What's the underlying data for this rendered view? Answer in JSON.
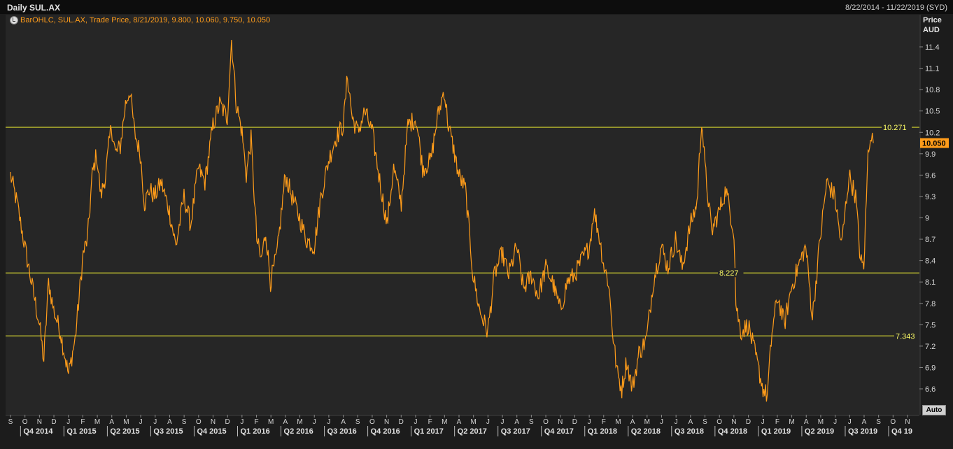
{
  "header": {
    "title": "Daily SUL.AX",
    "date_range": "8/22/2014 - 11/22/2019 (SYD)"
  },
  "legend": {
    "text": "BarOHLC, SUL.AX, Trade Price, 8/21/2019, 9.800, 10.060, 9.750, 10.050"
  },
  "y_axis_header": {
    "line1": "Price",
    "line2": "AUD"
  },
  "auto_button": "Auto",
  "colors": {
    "series": "#ff9c1a",
    "hline": "#ffff33",
    "last_price_bg": "#ff9c1a",
    "background": "#262626"
  },
  "chart_data": {
    "type": "line",
    "title": "Daily SUL.AX",
    "ylabel": "Price AUD",
    "ylim": [
      6.3,
      11.7
    ],
    "y_ticks": [
      "11.4",
      "11.1",
      "10.8",
      "10.5",
      "10.2",
      "9.9",
      "9.6",
      "9.3",
      "9",
      "8.7",
      "8.4",
      "8.1",
      "7.8",
      "7.5",
      "7.2",
      "6.9",
      "6.6"
    ],
    "x_month_ticks": [
      "S",
      "O",
      "N",
      "D",
      "J",
      "F",
      "M",
      "A",
      "M",
      "J",
      "J",
      "A",
      "S",
      "O",
      "N",
      "D",
      "J",
      "F",
      "M",
      "A",
      "M",
      "J",
      "J",
      "A",
      "S",
      "O",
      "N",
      "D",
      "J",
      "F",
      "M",
      "A",
      "M",
      "J",
      "J",
      "A",
      "S",
      "O",
      "N",
      "D",
      "J",
      "F",
      "M",
      "A",
      "M",
      "J",
      "J",
      "A",
      "S",
      "O",
      "N",
      "D",
      "J",
      "F",
      "M",
      "A",
      "M",
      "J",
      "J",
      "A",
      "S",
      "O",
      "N"
    ],
    "x_quarter_ticks": [
      "Q4 2014",
      "Q1 2015",
      "Q2 2015",
      "Q3 2015",
      "Q4 2015",
      "Q1 2016",
      "Q2 2016",
      "Q3 2016",
      "Q4 2016",
      "Q1 2017",
      "Q2 2017",
      "Q3 2017",
      "Q4 2017",
      "Q1 2018",
      "Q2 2018",
      "Q3 2018",
      "Q4 2018",
      "Q1 2019",
      "Q2 2019",
      "Q3 2019",
      "Q4 19"
    ],
    "horizontal_lines": [
      {
        "value": 10.271,
        "label": "10.271"
      },
      {
        "value": 8.227,
        "label": "8.227"
      },
      {
        "value": 7.343,
        "label": "7.343"
      }
    ],
    "last_price": {
      "value": 10.05,
      "label": "10.050"
    },
    "series": [
      {
        "name": "SUL.AX",
        "points": [
          [
            "2014-09-01",
            9.6
          ],
          [
            "2014-09-15",
            9.2
          ],
          [
            "2014-10-01",
            8.6
          ],
          [
            "2014-10-15",
            8.1
          ],
          [
            "2014-11-01",
            7.5
          ],
          [
            "2014-11-10",
            7.0
          ],
          [
            "2014-11-20",
            8.1
          ],
          [
            "2014-12-01",
            7.7
          ],
          [
            "2014-12-15",
            7.4
          ],
          [
            "2015-01-01",
            6.8
          ],
          [
            "2015-01-15",
            7.3
          ],
          [
            "2015-02-01",
            8.5
          ],
          [
            "2015-02-10",
            8.7
          ],
          [
            "2015-02-20",
            9.6
          ],
          [
            "2015-03-01",
            9.9
          ],
          [
            "2015-03-10",
            9.3
          ],
          [
            "2015-03-20",
            9.6
          ],
          [
            "2015-04-01",
            10.3
          ],
          [
            "2015-04-10",
            9.9
          ],
          [
            "2015-04-20",
            10.0
          ],
          [
            "2015-05-01",
            10.6
          ],
          [
            "2015-05-10",
            10.8
          ],
          [
            "2015-05-20",
            10.2
          ],
          [
            "2015-06-01",
            9.9
          ],
          [
            "2015-06-10",
            9.2
          ],
          [
            "2015-06-20",
            9.4
          ],
          [
            "2015-07-01",
            9.3
          ],
          [
            "2015-07-15",
            9.5
          ],
          [
            "2015-08-01",
            9.1
          ],
          [
            "2015-08-15",
            8.6
          ],
          [
            "2015-09-01",
            9.3
          ],
          [
            "2015-09-15",
            8.9
          ],
          [
            "2015-10-01",
            9.7
          ],
          [
            "2015-10-15",
            9.5
          ],
          [
            "2015-11-01",
            10.3
          ],
          [
            "2015-11-15",
            10.6
          ],
          [
            "2015-12-01",
            10.4
          ],
          [
            "2015-12-10",
            11.5
          ],
          [
            "2015-12-20",
            10.6
          ],
          [
            "2016-01-01",
            10.2
          ],
          [
            "2016-01-10",
            9.6
          ],
          [
            "2016-01-20",
            10.1
          ],
          [
            "2016-02-01",
            8.7
          ],
          [
            "2016-02-10",
            8.4
          ],
          [
            "2016-02-20",
            8.8
          ],
          [
            "2016-03-01",
            8.1
          ],
          [
            "2016-03-15",
            8.5
          ],
          [
            "2016-04-01",
            9.6
          ],
          [
            "2016-04-15",
            9.3
          ],
          [
            "2016-05-01",
            9.0
          ],
          [
            "2016-05-15",
            8.7
          ],
          [
            "2016-06-01",
            8.6
          ],
          [
            "2016-06-15",
            9.3
          ],
          [
            "2016-07-01",
            9.8
          ],
          [
            "2016-07-15",
            10.1
          ],
          [
            "2016-08-01",
            10.3
          ],
          [
            "2016-08-10",
            11.0
          ],
          [
            "2016-08-20",
            10.4
          ],
          [
            "2016-09-01",
            10.2
          ],
          [
            "2016-09-15",
            10.5
          ],
          [
            "2016-10-01",
            10.2
          ],
          [
            "2016-10-15",
            9.6
          ],
          [
            "2016-11-01",
            8.9
          ],
          [
            "2016-11-15",
            9.7
          ],
          [
            "2016-12-01",
            9.2
          ],
          [
            "2016-12-15",
            10.3
          ],
          [
            "2017-01-01",
            10.4
          ],
          [
            "2017-01-15",
            9.7
          ],
          [
            "2017-02-01",
            9.8
          ],
          [
            "2017-02-15",
            10.4
          ],
          [
            "2017-03-01",
            10.8
          ],
          [
            "2017-03-10",
            10.3
          ],
          [
            "2017-03-20",
            10.0
          ],
          [
            "2017-04-01",
            9.6
          ],
          [
            "2017-04-15",
            9.4
          ],
          [
            "2017-05-01",
            8.2
          ],
          [
            "2017-05-15",
            7.7
          ],
          [
            "2017-06-01",
            7.4
          ],
          [
            "2017-06-15",
            8.2
          ],
          [
            "2017-07-01",
            8.5
          ],
          [
            "2017-07-15",
            8.2
          ],
          [
            "2017-08-01",
            8.6
          ],
          [
            "2017-08-15",
            8.0
          ],
          [
            "2017-09-01",
            8.2
          ],
          [
            "2017-09-15",
            7.9
          ],
          [
            "2017-10-01",
            8.3
          ],
          [
            "2017-10-15",
            8.1
          ],
          [
            "2017-11-01",
            7.7
          ],
          [
            "2017-11-15",
            8.1
          ],
          [
            "2017-12-01",
            8.2
          ],
          [
            "2017-12-15",
            8.4
          ],
          [
            "2018-01-01",
            8.6
          ],
          [
            "2018-01-10",
            9.1
          ],
          [
            "2018-01-20",
            8.8
          ],
          [
            "2018-02-01",
            8.3
          ],
          [
            "2018-02-10",
            8.1
          ],
          [
            "2018-02-20",
            7.3
          ],
          [
            "2018-03-01",
            6.8
          ],
          [
            "2018-03-10",
            6.6
          ],
          [
            "2018-03-20",
            7.0
          ],
          [
            "2018-04-01",
            6.6
          ],
          [
            "2018-04-15",
            7.1
          ],
          [
            "2018-05-01",
            7.3
          ],
          [
            "2018-05-15",
            8.1
          ],
          [
            "2018-06-01",
            8.6
          ],
          [
            "2018-06-15",
            8.3
          ],
          [
            "2018-07-01",
            8.7
          ],
          [
            "2018-07-15",
            8.3
          ],
          [
            "2018-08-01",
            8.9
          ],
          [
            "2018-08-15",
            9.2
          ],
          [
            "2018-08-25",
            10.4
          ],
          [
            "2018-09-01",
            9.7
          ],
          [
            "2018-09-15",
            8.8
          ],
          [
            "2018-10-01",
            9.1
          ],
          [
            "2018-10-15",
            9.4
          ],
          [
            "2018-11-01",
            8.8
          ],
          [
            "2018-11-05",
            7.8
          ],
          [
            "2018-11-15",
            7.4
          ],
          [
            "2018-12-01",
            7.5
          ],
          [
            "2018-12-15",
            7.1
          ],
          [
            "2019-01-01",
            6.6
          ],
          [
            "2019-01-10",
            6.5
          ],
          [
            "2019-01-20",
            7.4
          ],
          [
            "2019-02-01",
            7.9
          ],
          [
            "2019-02-15",
            7.5
          ],
          [
            "2019-03-01",
            8.0
          ],
          [
            "2019-03-15",
            8.3
          ],
          [
            "2019-04-01",
            8.6
          ],
          [
            "2019-04-15",
            7.6
          ],
          [
            "2019-05-01",
            8.7
          ],
          [
            "2019-05-15",
            9.5
          ],
          [
            "2019-06-01",
            9.3
          ],
          [
            "2019-06-15",
            8.6
          ],
          [
            "2019-07-01",
            9.6
          ],
          [
            "2019-07-15",
            9.3
          ],
          [
            "2019-07-25",
            8.4
          ],
          [
            "2019-08-01",
            8.3
          ],
          [
            "2019-08-10",
            9.9
          ],
          [
            "2019-08-15",
            10.2
          ],
          [
            "2019-08-21",
            10.05
          ]
        ]
      }
    ],
    "grid": false
  }
}
